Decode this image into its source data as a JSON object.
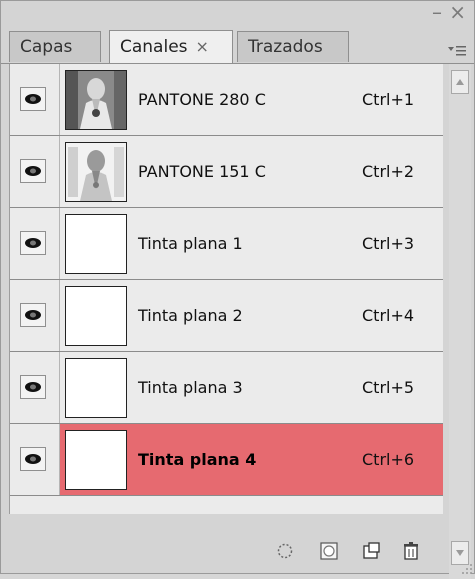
{
  "tabs": [
    {
      "label": "Capas"
    },
    {
      "label": "Canales",
      "close_glyph": "×"
    },
    {
      "label": "Trazados"
    }
  ],
  "window_controls": {
    "minimize": "–",
    "close": "×"
  },
  "channels": [
    {
      "name": "PANTONE 280 C",
      "shortcut": "Ctrl+1",
      "thumb": "image",
      "visible": true
    },
    {
      "name": "PANTONE 151 C",
      "shortcut": "Ctrl+2",
      "thumb": "image",
      "visible": true
    },
    {
      "name": "Tinta plana 1",
      "shortcut": "Ctrl+3",
      "thumb": "blank",
      "visible": true
    },
    {
      "name": "Tinta plana 2",
      "shortcut": "Ctrl+4",
      "thumb": "blank",
      "visible": true
    },
    {
      "name": "Tinta plana 3",
      "shortcut": "Ctrl+5",
      "thumb": "blank",
      "visible": true
    },
    {
      "name": "Tinta plana 4",
      "shortcut": "Ctrl+6",
      "thumb": "blank",
      "visible": true,
      "selected": true
    }
  ],
  "toolbar_icons": [
    "load-channel-as-selection-icon",
    "save-selection-as-channel-icon",
    "new-channel-icon",
    "trash-icon"
  ],
  "colors": {
    "selected_row": "#e66a70",
    "row_bg": "#ebebeb",
    "panel_bg": "#d4d4d4"
  }
}
